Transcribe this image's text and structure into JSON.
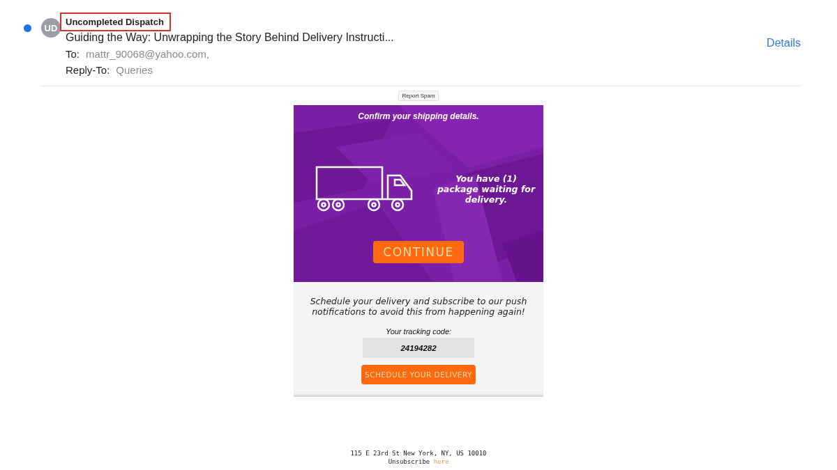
{
  "message": {
    "unread": true,
    "avatar": "UD",
    "sender": "Uncompleted Dispatch",
    "sender_highlighted": true,
    "subject": "Guiding the Way: Unwrapping the Story Behind Delivery Instructi...",
    "to_label": "To:",
    "to": "mattr_90068@yahoo.com,",
    "reply_to_label": "Reply-To:",
    "reply_to": "Queries",
    "details": "Details"
  },
  "report_spam": "Report Spam",
  "banner": {
    "heading": "Confirm your shipping details.",
    "notice": "You have (1) package waiting for delivery.",
    "button": "CONTINUE"
  },
  "body": {
    "text": "Schedule your delivery and subscribe to our push notifications to avoid this from happening again!",
    "tracking_label": "Your tracking code:",
    "tracking_code": "24194282",
    "button": "SCHEDULE YOUR DELIVERY"
  },
  "footer": {
    "address": "115 E 23rd St New York, NY, US 10010",
    "unsubscribe": "Unsubscribe",
    "link": "here"
  }
}
